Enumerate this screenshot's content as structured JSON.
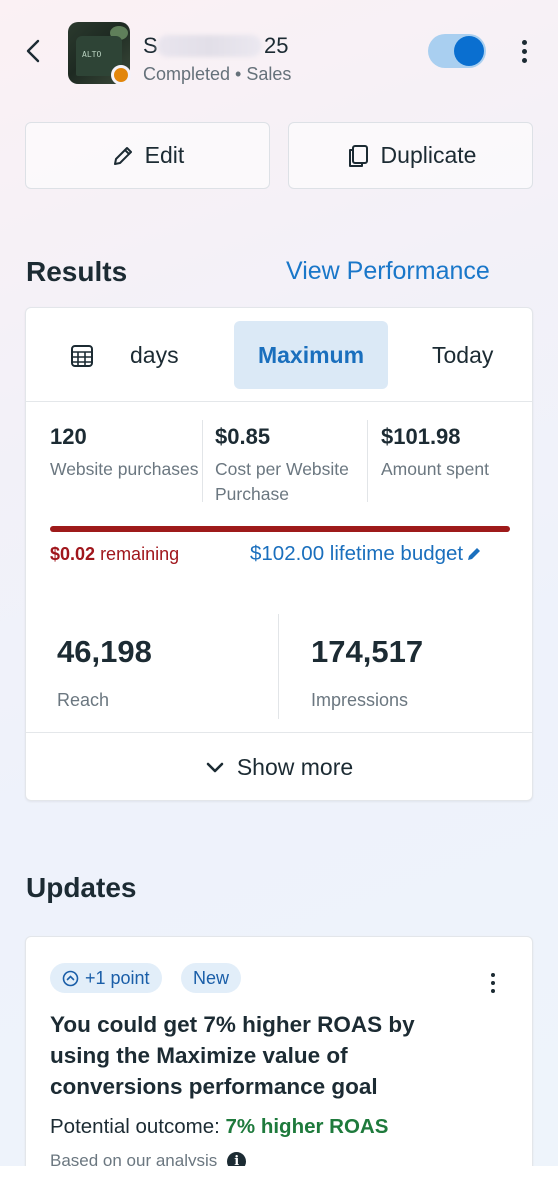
{
  "header": {
    "title_prefix": "S",
    "title_suffix": "25",
    "subtitle": "Completed • Sales",
    "status_color": "#e2860b",
    "toggle_on": true
  },
  "actions": {
    "edit_label": "Edit",
    "duplicate_label": "Duplicate"
  },
  "results": {
    "title": "Results",
    "view_performance": "View Performance",
    "tabs": {
      "days": "days",
      "maximum": "Maximum",
      "today": "Today"
    },
    "metrics": [
      {
        "value": "120",
        "label": "Website purchases"
      },
      {
        "value": "$0.85",
        "label": "Cost per Website Purchase"
      },
      {
        "value": "$101.98",
        "label": "Amount spent"
      }
    ],
    "budget": {
      "remaining_amount": "$0.02",
      "remaining_text": "remaining",
      "lifetime": "$102.00 lifetime budget",
      "spent_fraction": 0.9998
    },
    "big_metrics": [
      {
        "value": "46,198",
        "label": "Reach"
      },
      {
        "value": "174,517",
        "label": "Impressions"
      }
    ],
    "show_more": "Show more"
  },
  "updates": {
    "title": "Updates",
    "pill_points": "+1 point",
    "pill_new": "New",
    "headline": "You could get 7% higher ROAS by using the Maximize value of conversions performance goal",
    "outcome_prefix": "Potential outcome:",
    "outcome_value": "7% higher ROAS",
    "based_on": "Based on our analysis"
  },
  "colors": {
    "accent": "#1a6fbd",
    "budget_bar": "#9e1a1a",
    "positive": "#1e7a3c"
  }
}
